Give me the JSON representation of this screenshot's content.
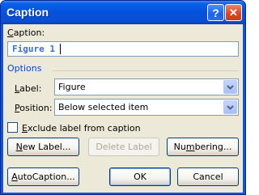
{
  "window": {
    "title": "Caption",
    "help_label": "?",
    "close_label": "✕"
  },
  "caption": {
    "label_prefix": "C",
    "label_rest": "aption:",
    "value": "Figure 1"
  },
  "options": {
    "heading": "Options",
    "label_field": {
      "label_prefix": "L",
      "label_rest": "abel:",
      "value": "Figure"
    },
    "position_field": {
      "label_prefix": "P",
      "label_rest": "osition:",
      "value": "Below selected item"
    }
  },
  "exclude_label": {
    "checked": false,
    "label_prefix": "E",
    "label_rest": "xclude label from caption"
  },
  "buttons": {
    "new_label_prefix": "N",
    "new_label_rest": "ew Label...",
    "delete_label": "Delete Label",
    "numbering_prefix": "Nu",
    "numbering_u": "m",
    "numbering_rest": "bering...",
    "autocaption_prefix": "A",
    "autocaption_rest": "utoCaption...",
    "ok": "OK",
    "cancel": "Cancel"
  },
  "icons": {
    "help": "help-icon",
    "close": "close-icon",
    "dropdown": "chevron-down-icon"
  },
  "colors": {
    "titlebar": "#0551dc",
    "dialog_bg": "#ece9d8",
    "section_heading": "#0046d5",
    "caption_text": "#3a6fc0"
  }
}
